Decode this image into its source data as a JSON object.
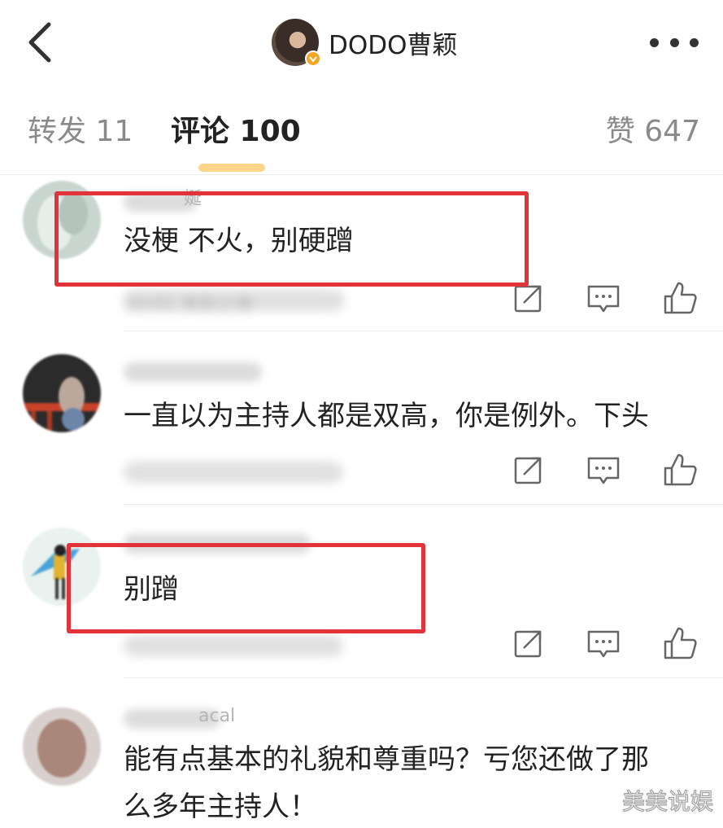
{
  "header": {
    "back_icon": "chevron-left-icon",
    "author_name": "DODO曹颖",
    "verified_badge_color": "#f4a623",
    "more_icon": "more-dots-icon"
  },
  "tabs": [
    {
      "label": "转发 11"
    },
    {
      "label": "评论 100"
    },
    {
      "label": "赞 647"
    }
  ],
  "comments": [
    {
      "name_visible": "娫",
      "text_lines": [
        "没梗 不火，别硬蹭"
      ],
      "meta_visible": "10:01 来自上海",
      "highlighted": true
    },
    {
      "name_visible": "",
      "text_lines": [
        "一直以为主持人都是双高，你是例外。下头"
      ],
      "meta_visible": "",
      "highlighted": false
    },
    {
      "name_visible": "",
      "text_lines": [
        "别蹭"
      ],
      "meta_visible": "",
      "highlighted": true
    },
    {
      "name_visible": "acal",
      "text_lines": [
        "能有点基本的礼貌和尊重吗？亏您还做了那",
        "么多年主持人！"
      ],
      "meta_visible": "",
      "highlighted": false
    }
  ],
  "action_icons": [
    "share-icon",
    "reply-icon",
    "like-icon"
  ],
  "highlight_color": "#e2333a",
  "watermark": "美美说娱"
}
